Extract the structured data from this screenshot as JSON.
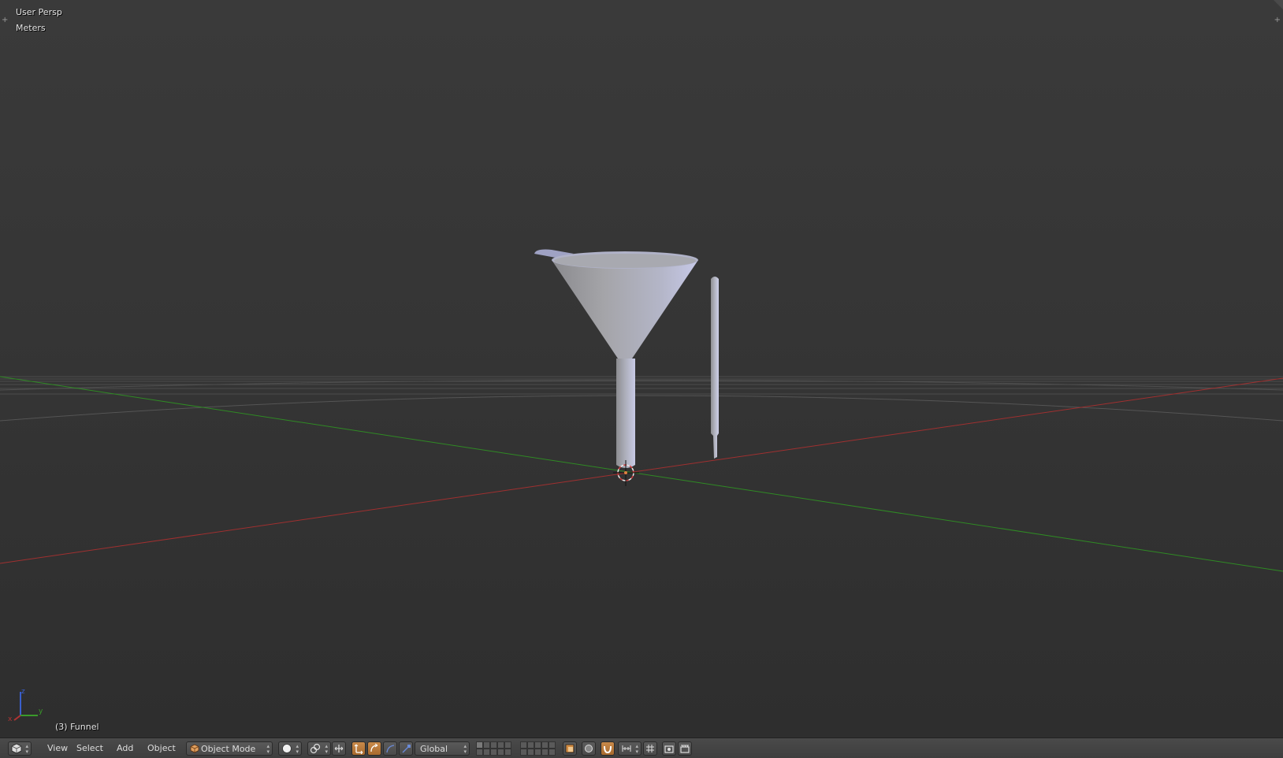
{
  "viewport": {
    "view_label": "User Persp",
    "units_label": "Meters",
    "active_object": "(3) Funnel",
    "axis_labels": {
      "x": "x",
      "y": "y",
      "z": "z"
    },
    "colors": {
      "x_axis": "#b03434",
      "y_axis": "#3a9a2a",
      "z_axis": "#3a5fcd",
      "object": "#a9aab6"
    }
  },
  "header": {
    "editor_type_icon": "3d-view-icon",
    "menus": {
      "view": "View",
      "select": "Select",
      "add": "Add",
      "object": "Object"
    },
    "mode": "Object Mode",
    "mode_icon": "cube-icon",
    "shading_icon": "solid-sphere-icon",
    "pivot_icon": "pivot-icon",
    "transform_orientation": "Global",
    "active_color": "#c98a4a"
  }
}
